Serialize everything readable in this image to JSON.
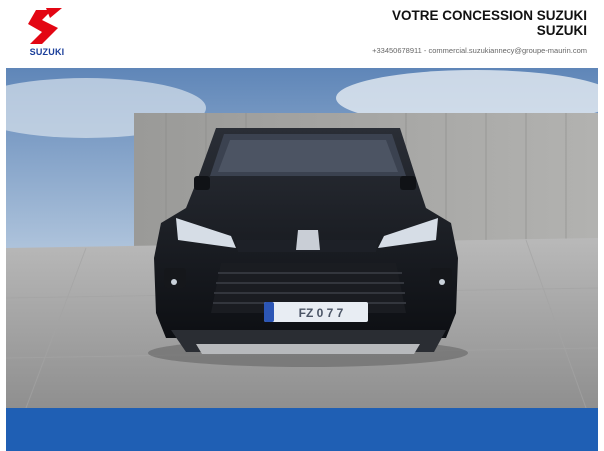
{
  "brand": {
    "logo_text": "SUZUKI",
    "logo_color": "#e30613",
    "text_color": "#1a3e9a"
  },
  "dealer": {
    "title_line1": "VOTRE CONCESSION SUZUKI",
    "title_line2": "SUZUKI",
    "contact": "+33450678911  -  commercial.suzukiannecy@groupe-maurin.com"
  },
  "hero": {
    "image_description_icon": "car-photo",
    "plate_text": "FZ 0 7 7"
  },
  "colors": {
    "bottom_bar": "#1f5fb4",
    "car_body": "#111318"
  }
}
